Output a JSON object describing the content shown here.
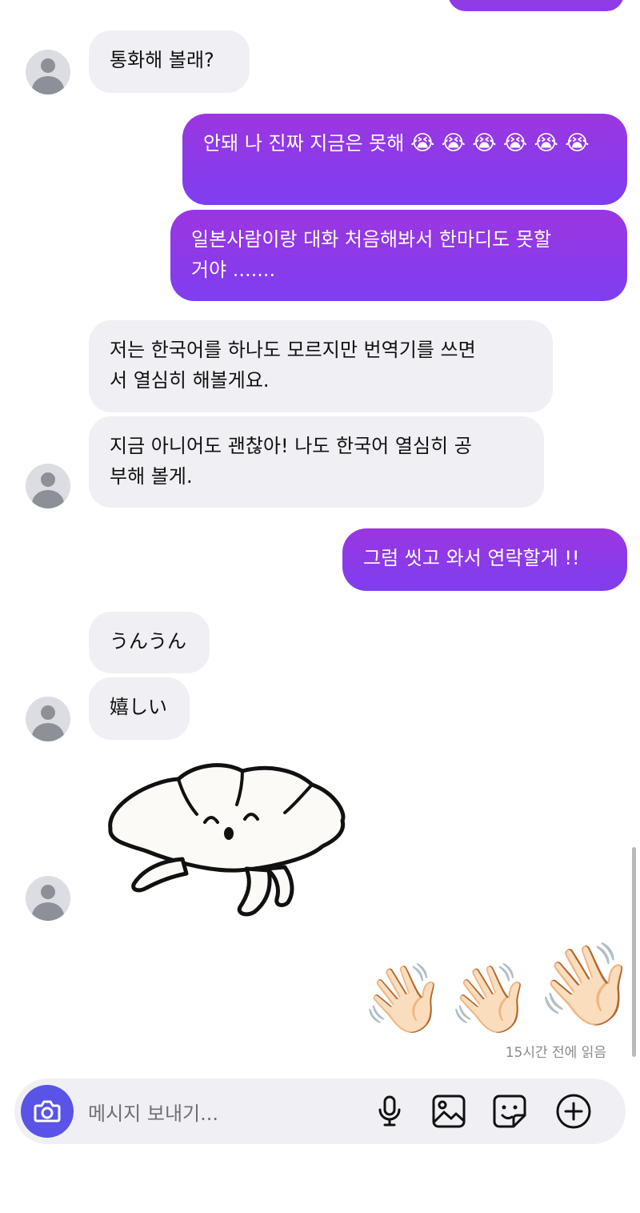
{
  "messages": {
    "m1": "통화해 볼래?",
    "m2": "안돼 나 진짜 지금은 못해",
    "m2_emojis": "😭 😭 😭 😭 😭 😭",
    "m3_line1": "일본사람이랑 대화 처음해봐서 한마디도 못할",
    "m3_line2": "거야 .......",
    "m4_line1": "저는 한국어를 하나도 모르지만 번역기를 쓰면",
    "m4_line2": "서 열심히 해볼게요.",
    "m5_line1": "지금 아니어도 괜찮아! 나도 한국어 열심히 공",
    "m5_line2": "부해 볼게.",
    "m6": "그럼 씻고 와서 연락할게 !!",
    "m7": "うんうん",
    "m8": "嬉しい",
    "waves": [
      "👋🏻",
      "👋🏻",
      "👋🏻"
    ]
  },
  "read_receipt": "15시간 전에 읽음",
  "composer": {
    "placeholder": "메시지 보내기..."
  },
  "icons": {
    "camera": "camera-icon",
    "mic": "microphone-icon",
    "image": "image-icon",
    "sticker": "sticker-icon",
    "plus": "plus-icon"
  },
  "colors": {
    "outgoing_top": "#9b36e0",
    "outgoing_bottom": "#7e3ef0",
    "incoming": "#efeff4",
    "camera_button": "#5a53e8"
  }
}
